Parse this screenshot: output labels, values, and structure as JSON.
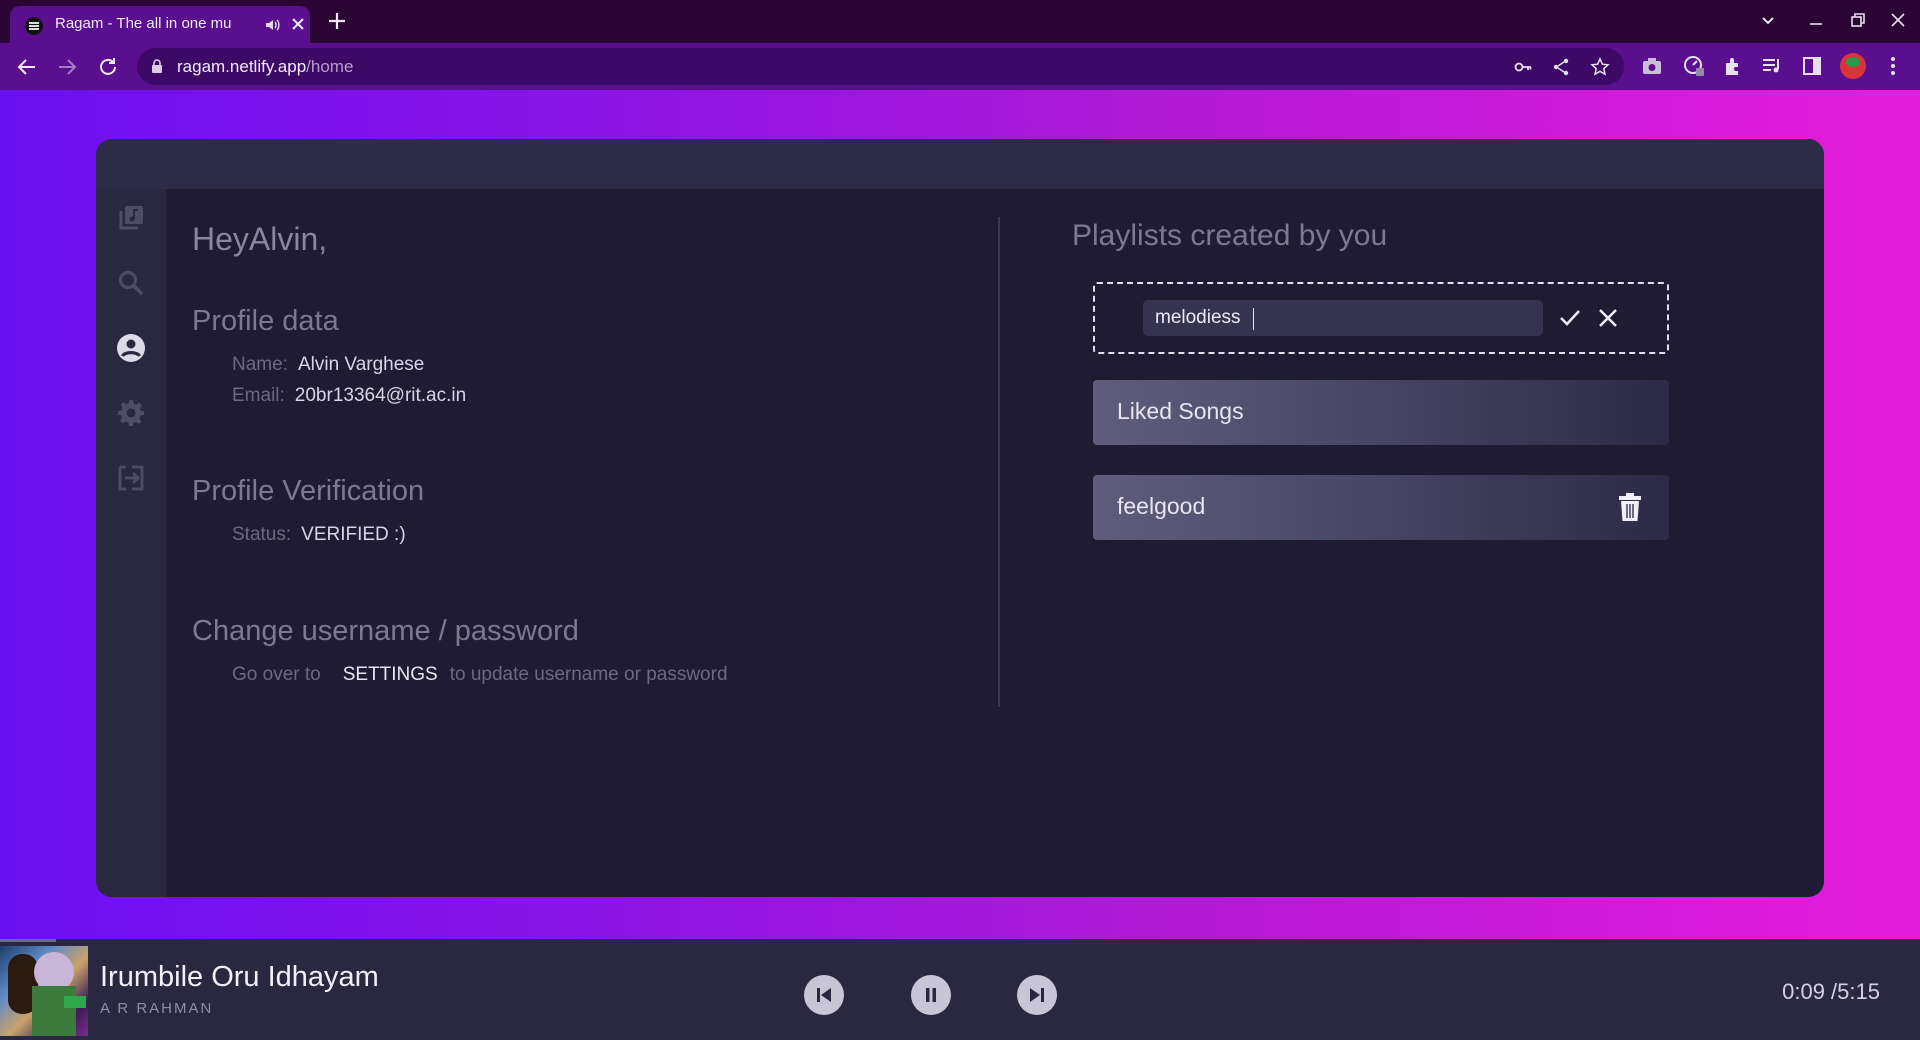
{
  "browser": {
    "tab_title": "Ragam - The all in one mu",
    "url_host": "ragam.netlify.app",
    "url_path": "/home"
  },
  "sidebar": {
    "items": [
      {
        "icon": "music-library-icon"
      },
      {
        "icon": "search-icon"
      },
      {
        "icon": "account-circle-icon"
      },
      {
        "icon": "gear-icon"
      },
      {
        "icon": "logout-icon"
      }
    ]
  },
  "profile": {
    "greeting": "HeyAlvin,",
    "profile_data_title": "Profile data",
    "name_label": "Name:",
    "name_value": "Alvin Varghese",
    "email_label": "Email:",
    "email_value": "20br13364@rit.ac.in",
    "verification_title": "Profile Verification",
    "status_label": "Status:",
    "status_value": "VERIFIED :)",
    "change_title": "Change username / password",
    "change_prefix": "Go over to",
    "change_link": "SETTINGS",
    "change_suffix": "to update username or password"
  },
  "playlists": {
    "title": "Playlists created by you",
    "new_playlist_value": "melodiess",
    "items": [
      {
        "name": "Liked Songs"
      },
      {
        "name": "feelgood"
      }
    ]
  },
  "player": {
    "song_title": "Irumbile Oru Idhayam",
    "artist": "A R RAHMAN",
    "time": "0:09 /5:15",
    "progress_fraction": 0.029
  },
  "colors": {
    "accent_gradient_start": "#6a10f0",
    "accent_gradient_end": "#e51cdb",
    "card_bg": "#1e1b33"
  }
}
